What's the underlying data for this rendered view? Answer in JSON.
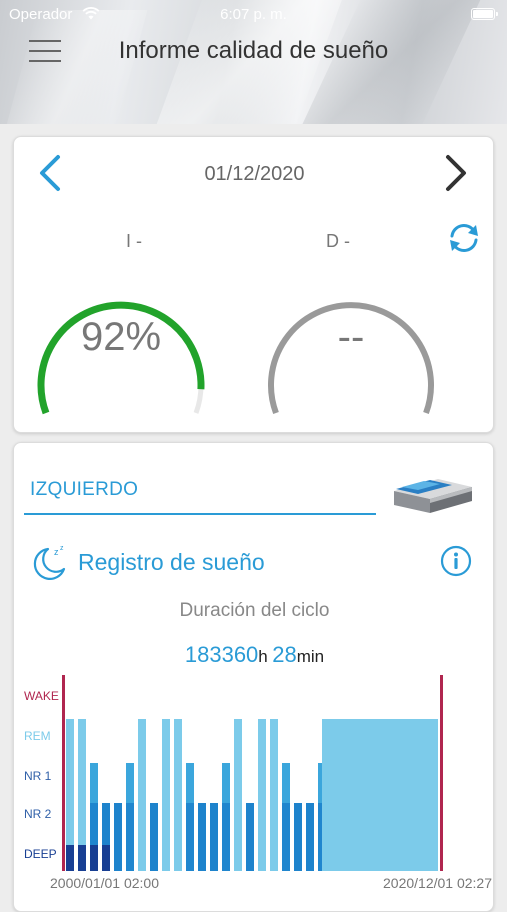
{
  "status_bar": {
    "carrier": "Operador",
    "time": "6:07 p. m."
  },
  "header": {
    "title": "Informe calidad de sueño"
  },
  "date_nav": {
    "date": "01/12/2020"
  },
  "gauges": [
    {
      "side": "I -",
      "value": "92%",
      "fraction": 0.92,
      "color": "#22a32b"
    },
    {
      "side": "D -",
      "value": "--",
      "fraction": 1.0,
      "color": "#9a9a9a"
    }
  ],
  "section": {
    "side_name": "IZQUIERDO",
    "title": "Registro de sueño",
    "cycle_label": "Duración del ciclo",
    "cycle_hours": "183360",
    "cycle_hours_unit": "h",
    "cycle_minutes": "28",
    "cycle_minutes_unit": "min"
  },
  "colors": {
    "accent": "#2a9bd6",
    "wake": "#b0264f",
    "rem": "#7ccbea",
    "nr1": "#3ba6dc",
    "nr2": "#1e83cc",
    "deep": "#183f93"
  },
  "chart_data": {
    "type": "bar",
    "y_levels": [
      "WAKE",
      "REM",
      "NR 1",
      "NR 2",
      "DEEP"
    ],
    "x_start_label": "2000/01/01 02:00",
    "x_end_label": "2020/12/01 02:27",
    "stage_pattern": [
      "REM",
      "REM",
      "NR 1",
      "NR 2",
      "NR 2",
      "NR 1",
      "REM",
      "NR 2"
    ],
    "final_stage": "REM"
  }
}
